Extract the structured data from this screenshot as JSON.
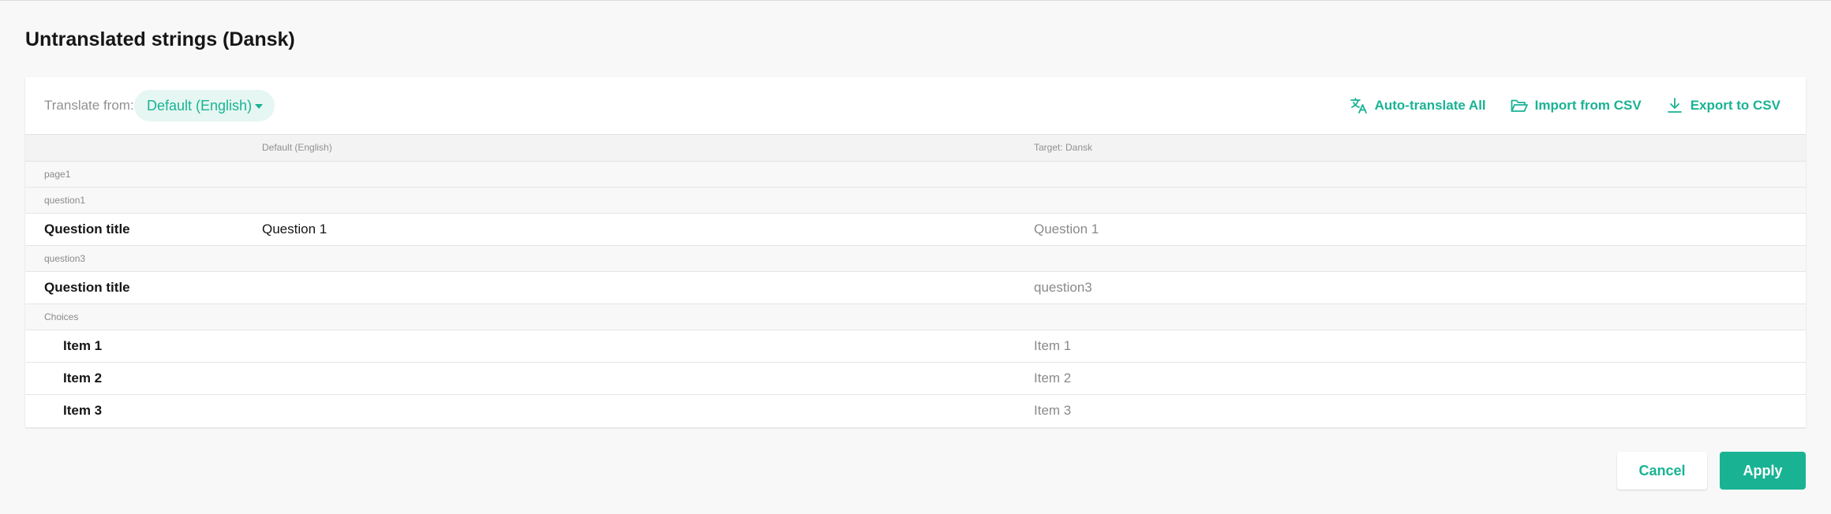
{
  "dialog": {
    "title": "Untranslated strings (Dansk)"
  },
  "toolbar": {
    "translate_from_label": "Translate from:",
    "translate_from_value": "Default (English)",
    "actions": [
      {
        "label": "Auto-translate All",
        "icon": "translate-icon"
      },
      {
        "label": "Import from CSV",
        "icon": "folder-open-icon"
      },
      {
        "label": "Export to CSV",
        "icon": "download-icon"
      }
    ]
  },
  "grid": {
    "columns": {
      "source": "Default (English)",
      "target": "Target: Dansk"
    },
    "rows": [
      {
        "type": "group",
        "label": "page1"
      },
      {
        "type": "group",
        "label": "question1"
      },
      {
        "type": "item",
        "name": "Question title",
        "source": "Question 1",
        "target": "Question 1"
      },
      {
        "type": "group",
        "label": "question3"
      },
      {
        "type": "item",
        "name": "Question title",
        "source": "",
        "target": "question3"
      },
      {
        "type": "group",
        "label": "Choices"
      },
      {
        "type": "item",
        "name": "Item 1",
        "source": "",
        "target": "Item 1"
      },
      {
        "type": "item",
        "name": "Item 2",
        "source": "",
        "target": "Item 2"
      },
      {
        "type": "item",
        "name": "Item 3",
        "source": "",
        "target": "Item 3"
      }
    ]
  },
  "buttons": {
    "cancel": "Cancel",
    "apply": "Apply"
  },
  "colors": {
    "accent": "#19b394",
    "accent_light": "#e6f6f2",
    "background": "#f8f8f8"
  }
}
